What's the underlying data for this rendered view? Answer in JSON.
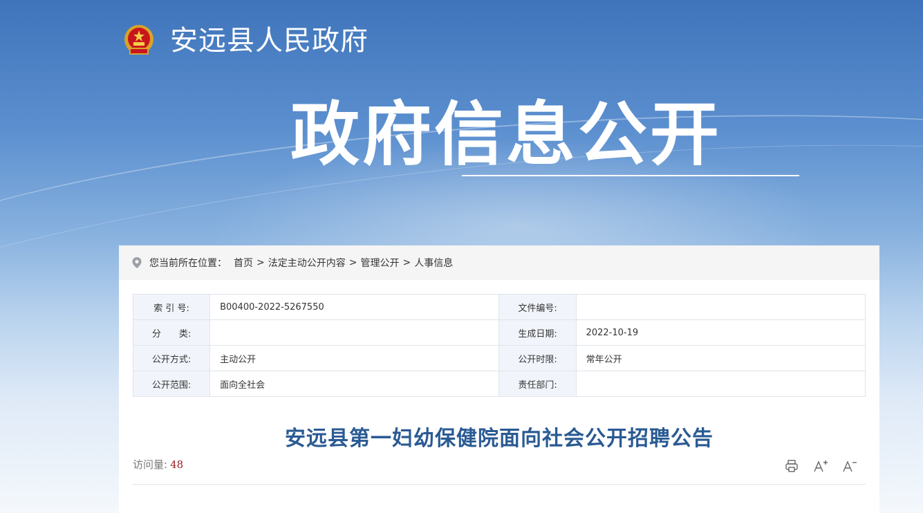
{
  "header": {
    "site_name": "安远县人民政府",
    "banner_title": "政府信息公开"
  },
  "breadcrumb": {
    "prefix": "您当前所在位置：",
    "items": [
      "首页",
      "法定主动公开内容",
      "管理公开",
      "人事信息"
    ],
    "separator": ">"
  },
  "meta": {
    "rows": [
      {
        "k1": "索 引 号:",
        "v1": "B00400-2022-5267550",
        "k2": "文件编号:",
        "v2": ""
      },
      {
        "k1": "分　　类:",
        "v1": "",
        "k2": "生成日期:",
        "v2": "2022-10-19"
      },
      {
        "k1": "公开方式:",
        "v1": "主动公开",
        "k2": "公开时限:",
        "v2": "常年公开"
      },
      {
        "k1": "公开范围:",
        "v1": "面向全社会",
        "k2": "责任部门:",
        "v2": ""
      }
    ]
  },
  "article": {
    "title": "安远县第一妇幼保健院面向社会公开招聘公告",
    "visits_label": "访问量:",
    "visits_count": "48"
  },
  "tools": {
    "increase": "A+",
    "decrease": "A-"
  },
  "colors": {
    "title": "#2a5a93",
    "visits_count": "#9b1c1c"
  },
  "icons": [
    "emblem-icon",
    "location-pin-icon",
    "print-icon",
    "font-increase-icon",
    "font-decrease-icon"
  ]
}
